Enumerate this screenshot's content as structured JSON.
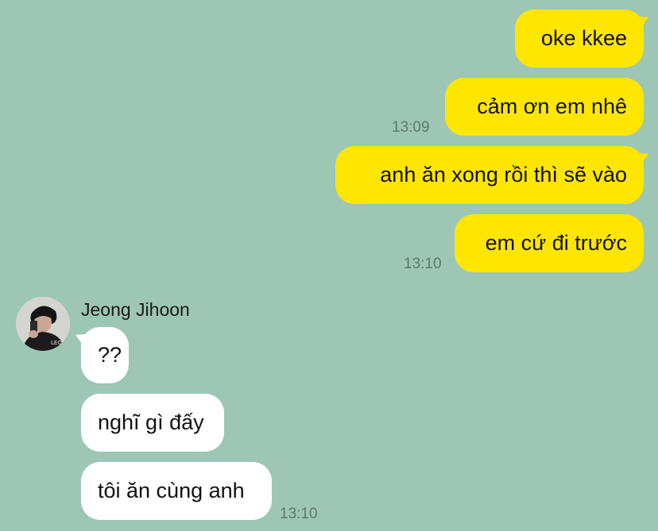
{
  "chat": {
    "outgoing": [
      {
        "text": "oke kkee"
      },
      {
        "text": "cảm ơn em nhê"
      },
      {
        "text": "anh ăn xong rồi thì sẽ vào"
      },
      {
        "text": "em cứ đi trước"
      }
    ],
    "outgoing_times": [
      "13:09",
      "13:10"
    ],
    "sender": {
      "name": "Jeong Jihoon",
      "avatar_icon": "person-avatar-icon"
    },
    "incoming": [
      {
        "text": "??"
      },
      {
        "text": "nghĩ gì đấy"
      },
      {
        "text": "tôi ăn cùng anh"
      }
    ],
    "incoming_time": "13:10"
  },
  "colors": {
    "background": "#9dc6b5",
    "outgoing_bubble": "#ffe600",
    "incoming_bubble": "#ffffff",
    "timestamp": "#5c7a6e"
  }
}
